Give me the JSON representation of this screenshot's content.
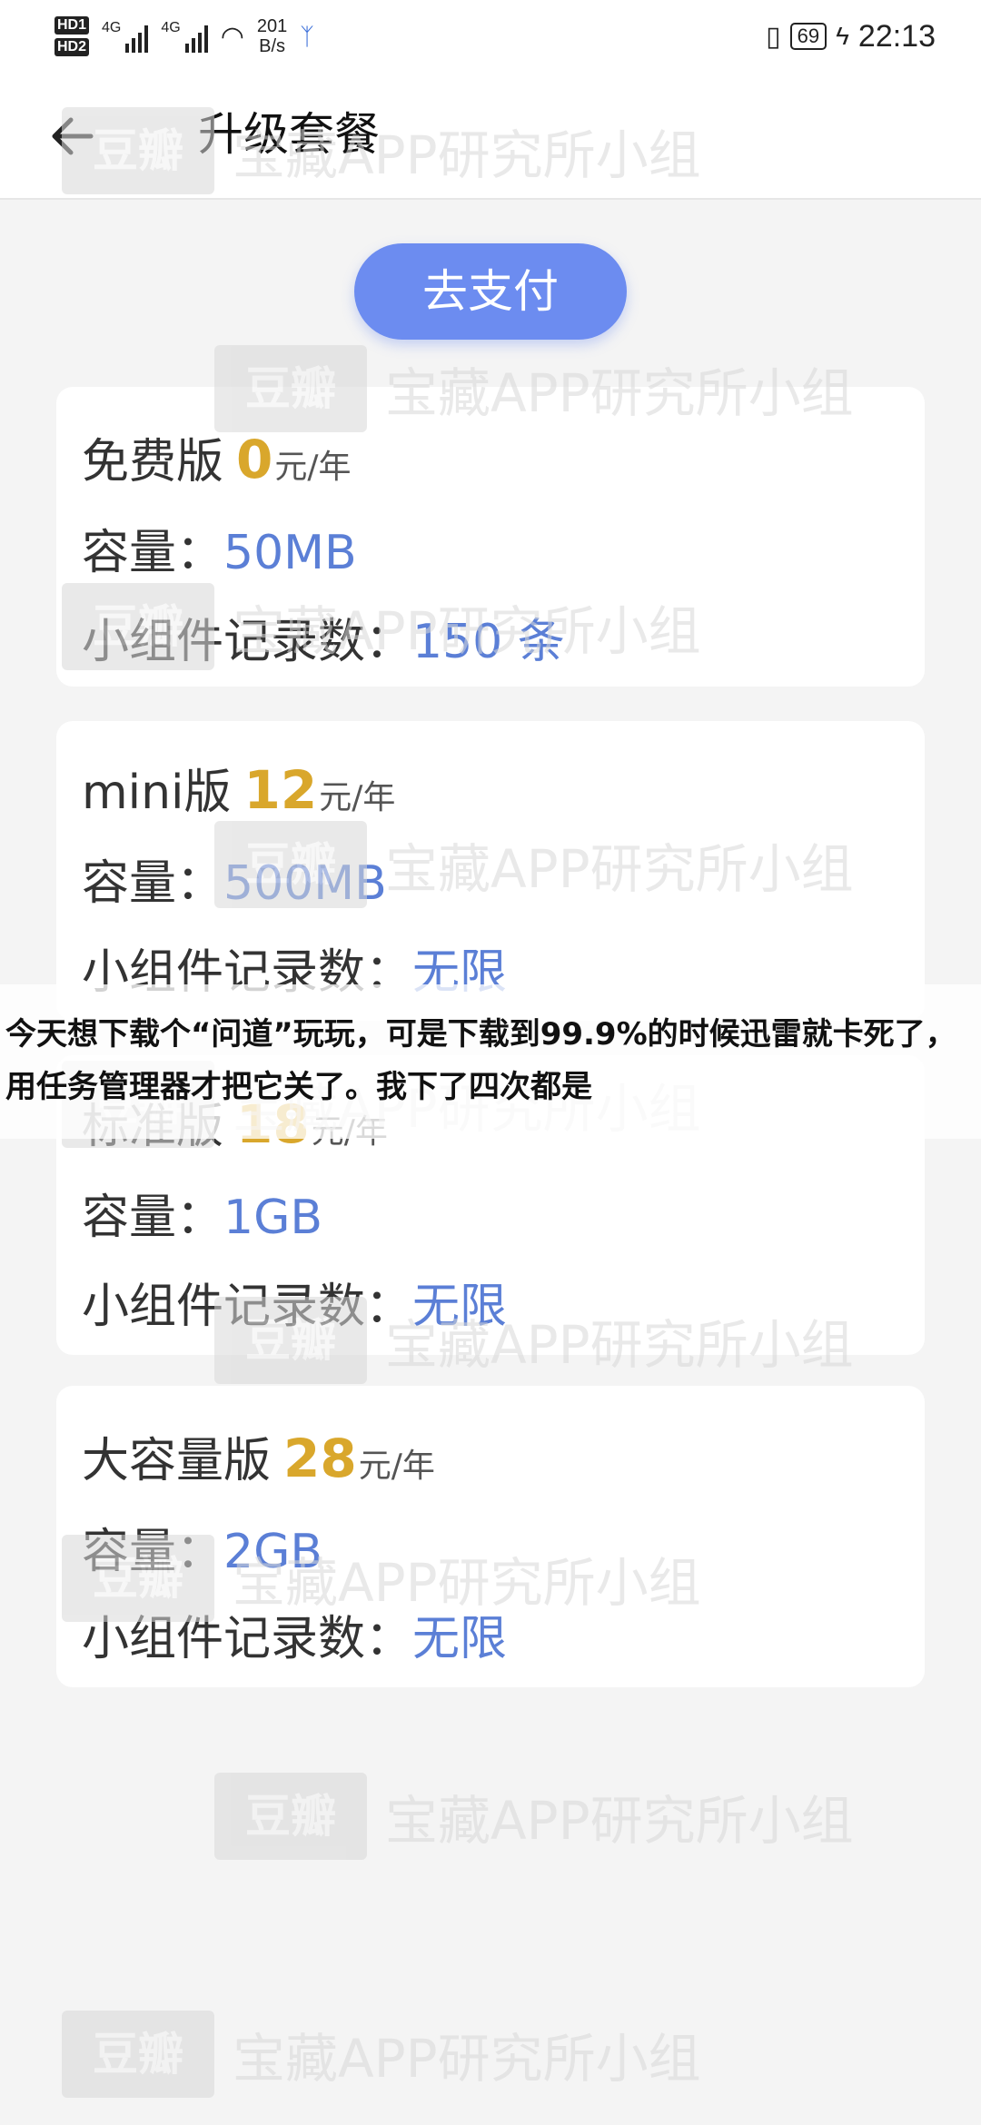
{
  "status_bar": {
    "hd1": "HD1",
    "hd2": "HD2",
    "net1": "4G",
    "net2": "4G",
    "speed_value": "201",
    "speed_unit": "B/s",
    "battery": "69",
    "time": "22:13",
    "icons": [
      "hd-icon",
      "signal-icon",
      "wifi-icon",
      "app-notification-icon",
      "vibrate-icon",
      "battery-icon",
      "charging-icon"
    ]
  },
  "appbar": {
    "title": "升级套餐",
    "back_icon": "arrow-left-icon"
  },
  "pay_button": {
    "label": "去支付"
  },
  "plans": [
    {
      "name": "免费版",
      "price": "0",
      "unit": "元/年",
      "capacity_label": "容量：",
      "capacity": "50MB",
      "records_label": "小组件记录数：",
      "records": "150 条"
    },
    {
      "name": "mini版",
      "price": "12",
      "unit": "元/年",
      "capacity_label": "容量：",
      "capacity": "500MB",
      "records_label": "小组件记录数：",
      "records": "无限"
    },
    {
      "name": "标准版",
      "price": "18",
      "unit": "元/年",
      "capacity_label": "容量：",
      "capacity": "1GB",
      "records_label": "小组件记录数：",
      "records": "无限"
    },
    {
      "name": "大容量版",
      "price": "28",
      "unit": "元/年",
      "capacity_label": "容量：",
      "capacity": "2GB",
      "records_label": "小组件记录数：",
      "records": "无限"
    }
  ],
  "watermark": {
    "logo": "豆瓣",
    "text": "宝藏APP研究所小组"
  },
  "caption": "今天想下载个“问道”玩玩，可是下载到99.9%的时候迅雷就卡死了，用任务管理器才把它关了。我下了四次都是",
  "colors": {
    "accent": "#6c8cf0",
    "price": "#d9a72c",
    "value": "#5b7fd6"
  }
}
